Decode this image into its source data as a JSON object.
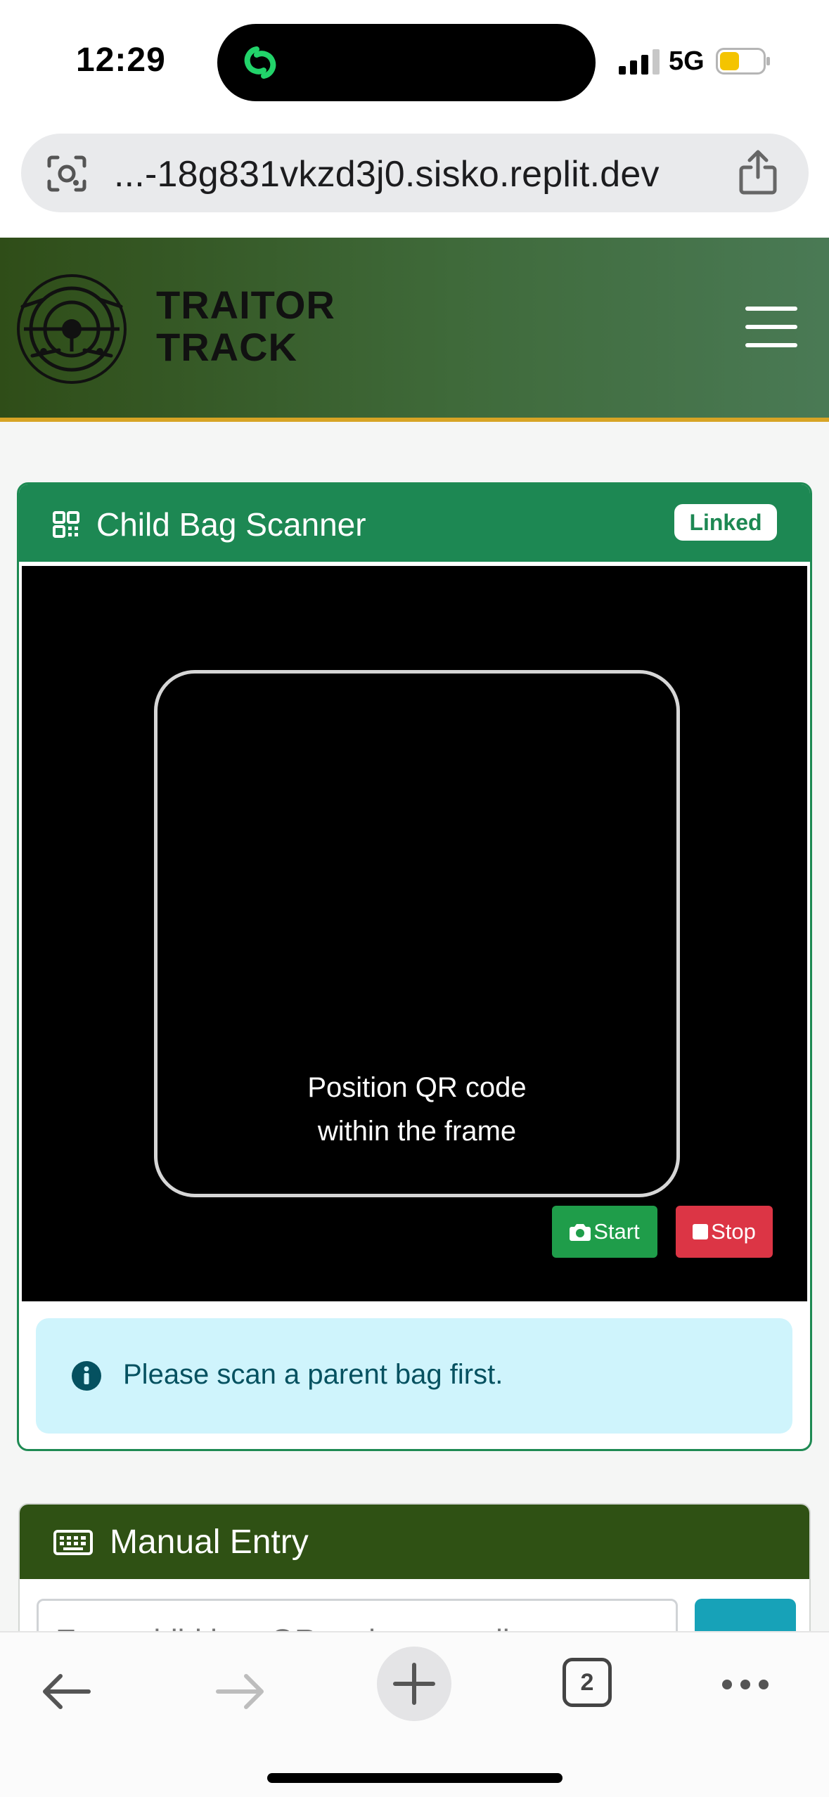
{
  "status_bar": {
    "time": "12:29",
    "network": "5G",
    "battery_level": 0.45,
    "battery_color": "#f4c400"
  },
  "browser": {
    "url": "...-18g831vkzd3j0.sisko.replit.dev",
    "tab_count": "2"
  },
  "header": {
    "brand_line1": "TRAITOR",
    "brand_line2": "TRACK",
    "colors": {
      "bar_start": "#2f4d18",
      "bar_end": "#4a7a55",
      "accent": "#d7a425"
    }
  },
  "scanner": {
    "title": "Child Bag Scanner",
    "badge": "Linked",
    "hint": "Position QR code\nwithin the frame",
    "start_label": "Start",
    "stop_label": "Stop",
    "alert": "Please scan a parent bag first.",
    "colors": {
      "header": "#1d8853",
      "start": "#1f9d4a",
      "stop": "#dc3545",
      "alert_bg": "#cff4fc"
    }
  },
  "manual_entry": {
    "title": "Manual Entry",
    "placeholder": "Enter child bag QR code manually",
    "colors": {
      "header": "#2f5114",
      "submit": "#17a2b8"
    }
  },
  "icons": {
    "island": "link-app-icon",
    "lens": "camera-lens-icon",
    "share": "share-icon",
    "qr": "qrcode-icon",
    "camera": "camera-icon",
    "stop": "stop-square-icon",
    "info": "info-circle-icon",
    "keyboard": "keyboard-icon"
  }
}
